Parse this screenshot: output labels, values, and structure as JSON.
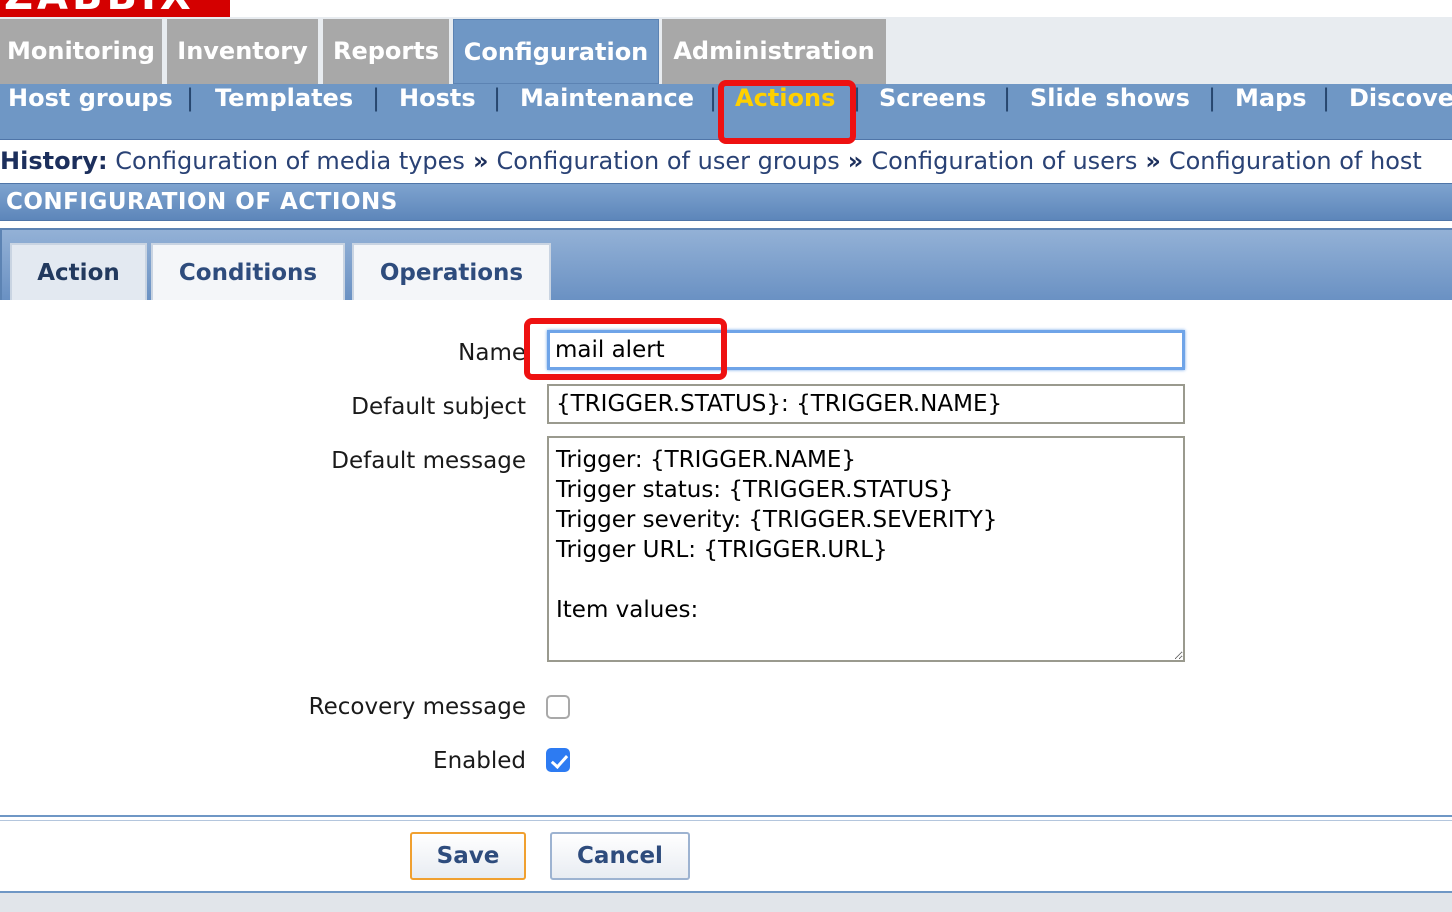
{
  "logo": {
    "text": "ZABBIX"
  },
  "main_menu": [
    {
      "label": "Monitoring",
      "active": false
    },
    {
      "label": "Inventory",
      "active": false
    },
    {
      "label": "Reports",
      "active": false
    },
    {
      "label": "Configuration",
      "active": true
    },
    {
      "label": "Administration",
      "active": false
    }
  ],
  "sub_menu": [
    {
      "label": "Host groups",
      "active": false
    },
    {
      "label": "Templates",
      "active": false
    },
    {
      "label": "Hosts",
      "active": false
    },
    {
      "label": "Maintenance",
      "active": false
    },
    {
      "label": "Actions",
      "active": true
    },
    {
      "label": "Screens",
      "active": false
    },
    {
      "label": "Slide shows",
      "active": false
    },
    {
      "label": "Maps",
      "active": false
    },
    {
      "label": "Discove",
      "active": false
    }
  ],
  "history": {
    "label": "History:",
    "separator": "»",
    "items": [
      "Configuration of media types",
      "Configuration of user groups",
      "Configuration of users",
      "Configuration of host"
    ]
  },
  "page_title": "CONFIGURATION OF ACTIONS",
  "tabs": [
    {
      "label": "Action",
      "active": true
    },
    {
      "label": "Conditions",
      "active": false
    },
    {
      "label": "Operations",
      "active": false
    }
  ],
  "form": {
    "name_label": "Name",
    "name_value": "mail alert",
    "subject_label": "Default subject",
    "subject_value": "{TRIGGER.STATUS}: {TRIGGER.NAME}",
    "message_label": "Default message",
    "message_value": "Trigger: {TRIGGER.NAME}\nTrigger status: {TRIGGER.STATUS}\nTrigger severity: {TRIGGER.SEVERITY}\nTrigger URL: {TRIGGER.URL}\n\nItem values:\n\n",
    "recovery_label": "Recovery message",
    "recovery_checked": false,
    "enabled_label": "Enabled",
    "enabled_checked": true
  },
  "buttons": {
    "save": "Save",
    "cancel": "Cancel"
  },
  "colors": {
    "menu_blue": "#6f97c5",
    "menu_gray": "#a8a8a8",
    "active_submenu": "#ffd000",
    "highlight_red": "#ee1111",
    "focus_blue": "#6fa4e8",
    "checkbox_blue": "#2d7bf2"
  }
}
